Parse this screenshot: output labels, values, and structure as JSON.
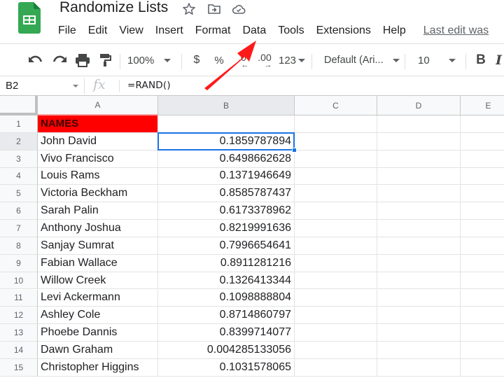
{
  "app": {
    "title": "Randomize Lists",
    "last_edit": "Last edit was",
    "accent_color": "#1a73e8",
    "logo_color": "#34a853"
  },
  "menu": [
    {
      "label": "File"
    },
    {
      "label": "Edit"
    },
    {
      "label": "View"
    },
    {
      "label": "Insert"
    },
    {
      "label": "Format"
    },
    {
      "label": "Data"
    },
    {
      "label": "Tools"
    },
    {
      "label": "Extensions"
    },
    {
      "label": "Help"
    }
  ],
  "title_icons": [
    "star-icon",
    "move-to-folder-icon",
    "cloud-saved-icon"
  ],
  "toolbar": {
    "undo": "undo-icon",
    "redo": "redo-icon",
    "print": "print-icon",
    "paint_format": "paint-format-icon",
    "zoom": "100%",
    "currency": "$",
    "percent": "%",
    "decrease_decimal": ".0",
    "increase_decimal": ".00",
    "more_formats": "123",
    "font": "Default (Ari...",
    "font_size": "10",
    "bold": "B"
  },
  "formula_bar": {
    "name_box": "B2",
    "fx": "fx",
    "formula": "=RAND()"
  },
  "grid": {
    "columns": [
      "A",
      "B",
      "C",
      "D",
      "E"
    ],
    "active_cell": "B2",
    "header_fill_color": "#ff0000",
    "rows": [
      {
        "num": "1",
        "a": "NAMES",
        "b": ""
      },
      {
        "num": "2",
        "a": "John David",
        "b": "0.1859787894"
      },
      {
        "num": "3",
        "a": "Vivo Francisco",
        "b": "0.6498662628"
      },
      {
        "num": "4",
        "a": "Louis Rams",
        "b": "0.1371946649"
      },
      {
        "num": "5",
        "a": "Victoria Beckham",
        "b": "0.8585787437"
      },
      {
        "num": "6",
        "a": "Sarah Palin",
        "b": "0.6173378962"
      },
      {
        "num": "7",
        "a": "Anthony Joshua",
        "b": "0.8219991636"
      },
      {
        "num": "8",
        "a": "Sanjay Sumrat",
        "b": "0.7996654641"
      },
      {
        "num": "9",
        "a": "Fabian Wallace",
        "b": "0.8911281216"
      },
      {
        "num": "10",
        "a": "Willow Creek",
        "b": "0.1326413344"
      },
      {
        "num": "11",
        "a": "Levi Ackermann",
        "b": "0.1098888804"
      },
      {
        "num": "12",
        "a": "Ashley Cole",
        "b": "0.8714860797"
      },
      {
        "num": "13",
        "a": "Phoebe Dannis",
        "b": "0.8399714077"
      },
      {
        "num": "14",
        "a": "Dawn Graham",
        "b": "0.004285133056"
      },
      {
        "num": "15",
        "a": "Christopher Higgins",
        "b": "0.1031578065"
      }
    ]
  },
  "annotation": {
    "type": "arrow",
    "points_to": "Data menu",
    "color": "#ff1a1a"
  }
}
